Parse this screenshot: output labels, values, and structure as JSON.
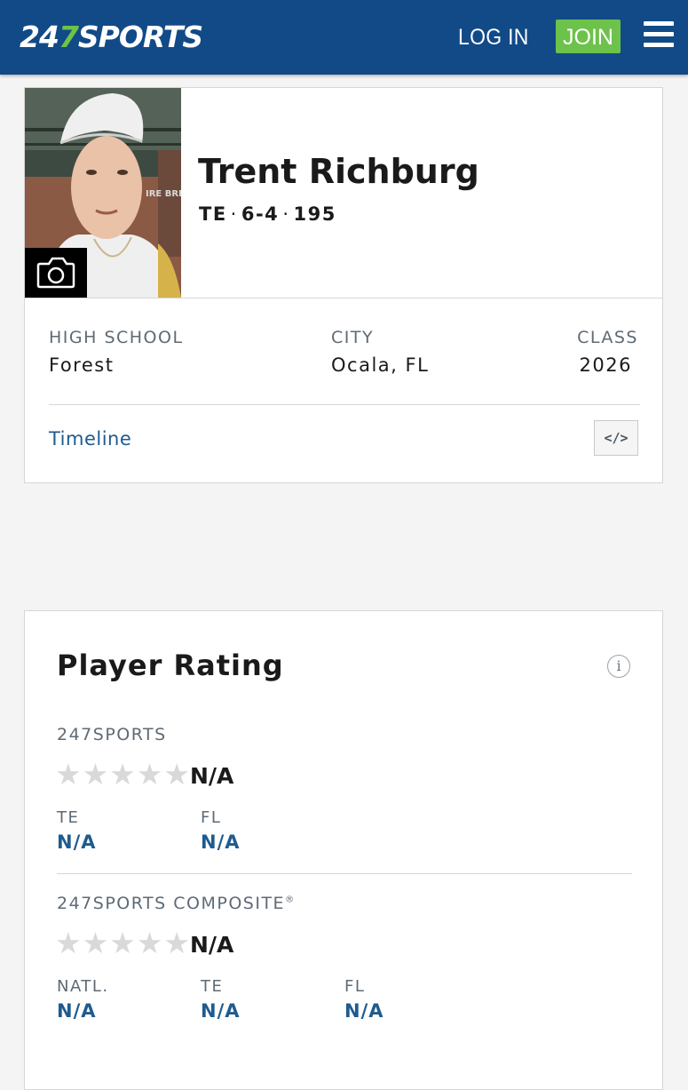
{
  "header": {
    "logo": {
      "part1": "24",
      "part2": "7",
      "part3": "SPORTS"
    },
    "login_label": "LOG IN",
    "join_label": "JOIN",
    "menu_icon": "hamburger-menu-icon"
  },
  "player": {
    "name": "Trent Richburg",
    "position": "TE",
    "height": "6-4",
    "weight": "195",
    "separator": "·",
    "photo_icon": "camera-icon"
  },
  "details": {
    "high_school_label": "HIGH SCHOOL",
    "high_school_value": "Forest",
    "city_label": "CITY",
    "city_value": "Ocala, FL",
    "class_label": "CLASS",
    "class_value": "2026",
    "timeline_link": "Timeline",
    "embed_label": "</>"
  },
  "rating": {
    "title": "Player Rating",
    "info_icon_label": "i",
    "sports247": {
      "label": "247SPORTS",
      "stars_filled": 0,
      "stars_total": 5,
      "overall": "N/A",
      "rank_labels": [
        "TE",
        "FL"
      ],
      "rank_values": [
        "N/A",
        "N/A"
      ]
    },
    "composite": {
      "label": "247SPORTS COMPOSITE",
      "registered_mark": "®",
      "stars_filled": 0,
      "stars_total": 5,
      "overall": "N/A",
      "rank_labels": [
        "NATL.",
        "TE",
        "FL"
      ],
      "rank_values": [
        "N/A",
        "N/A",
        "N/A"
      ]
    }
  },
  "colors": {
    "header_bg": "#114a87",
    "accent_green": "#6cc24a",
    "link_blue": "#1e5b8f",
    "muted_label": "#5e6a75",
    "empty_star": "#d9d9d9"
  }
}
